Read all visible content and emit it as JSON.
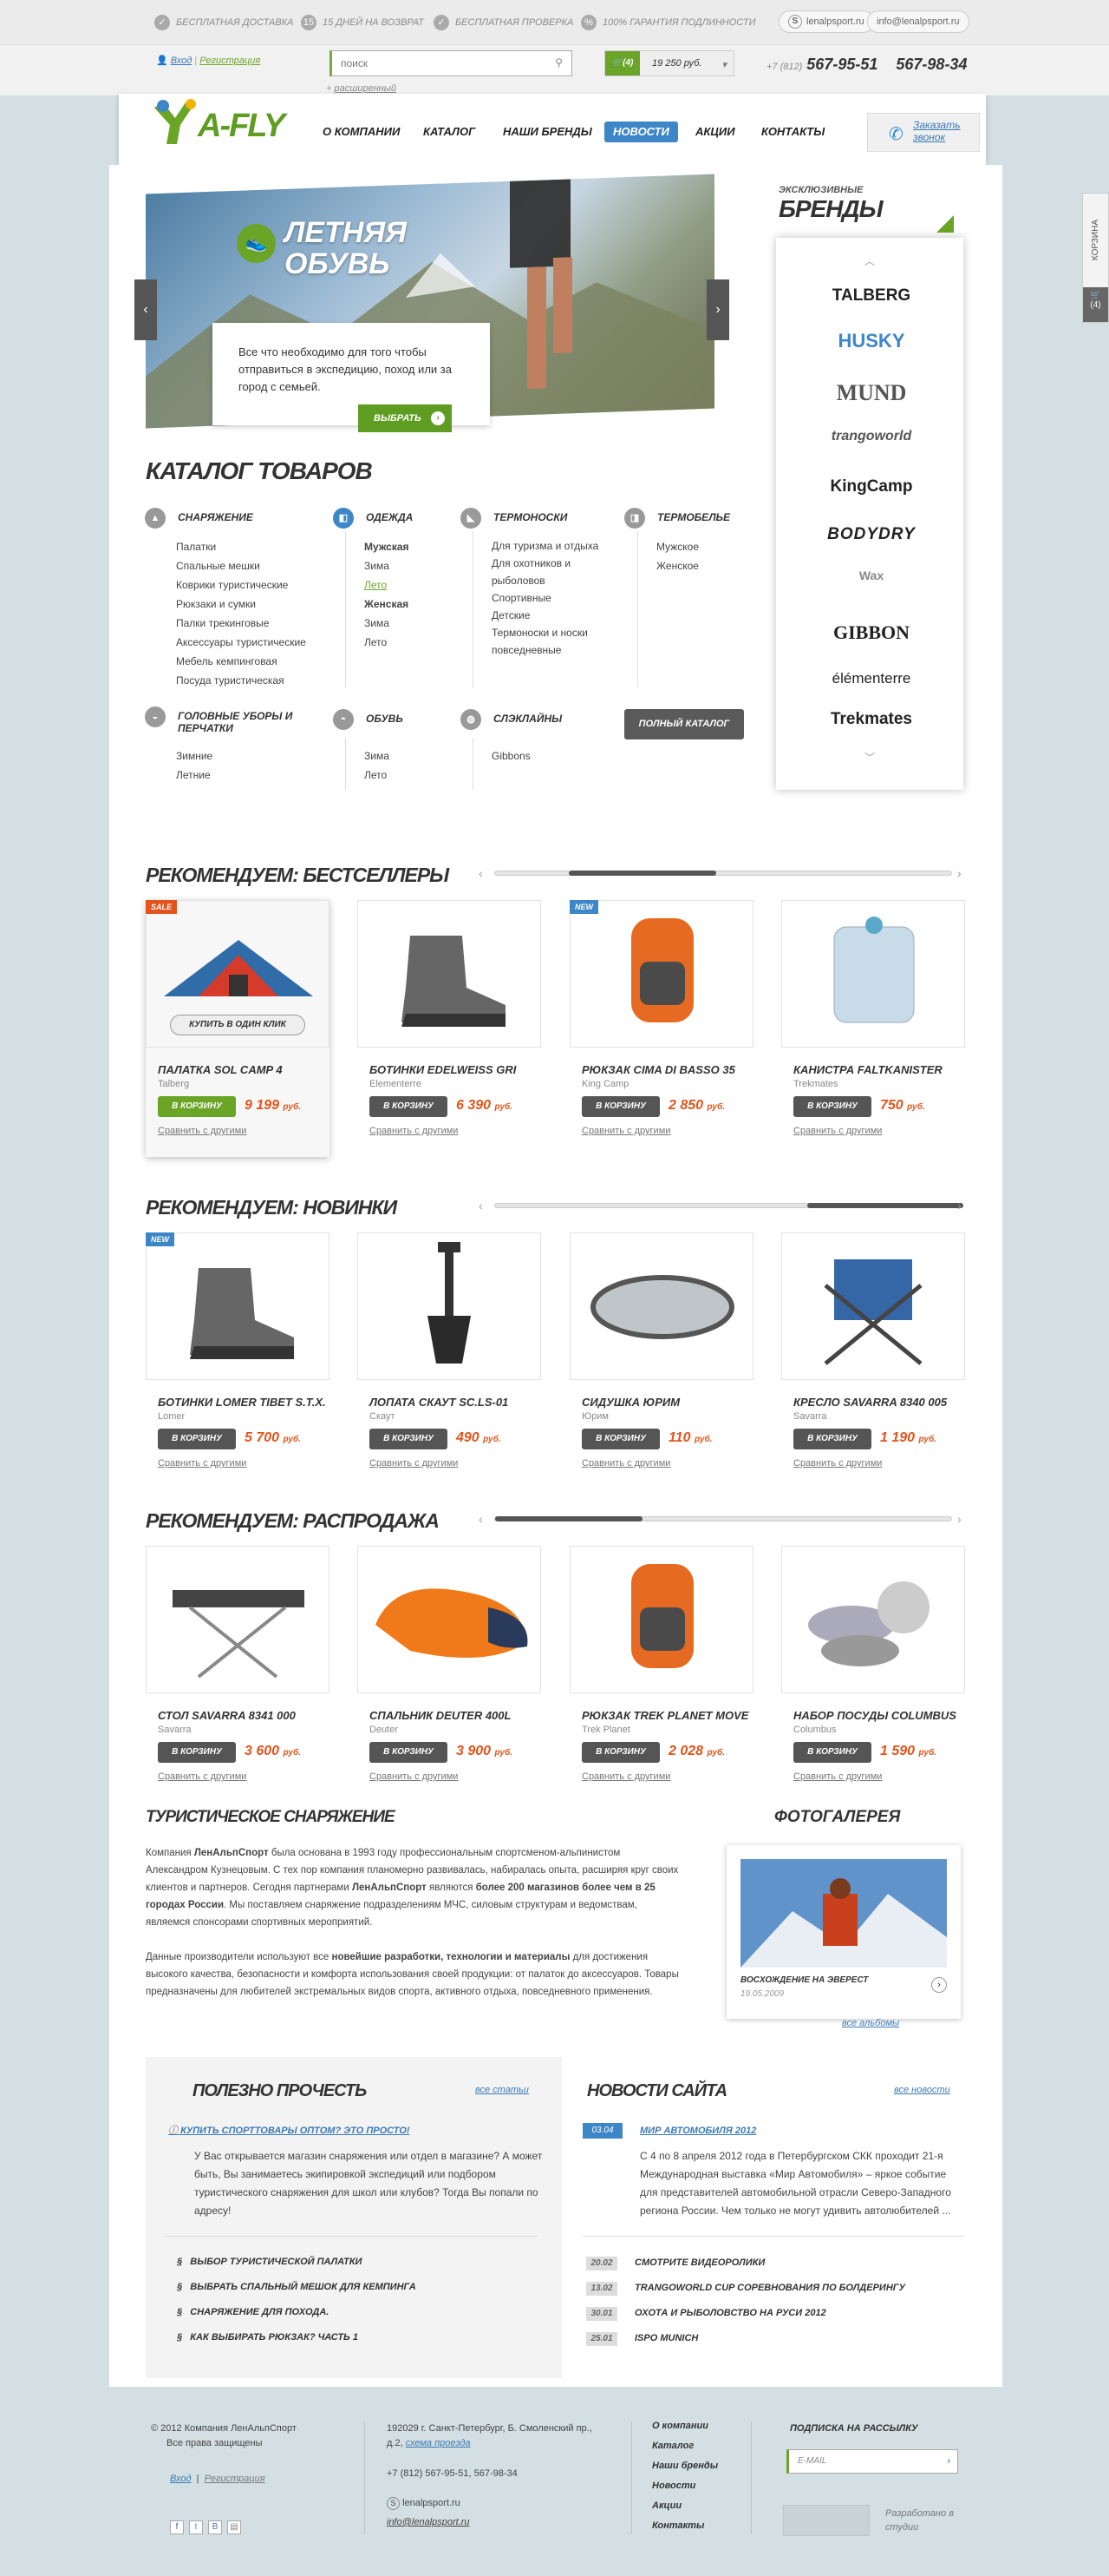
{
  "topbar": {
    "badges": [
      "БЕСПЛАТНАЯ ДОСТАВКА",
      "15 ДНЕЙ НА ВОЗВРАТ",
      "БЕСПЛАТНАЯ ПРОВЕРКА",
      "100% ГАРАНТИЯ ПОДЛИННОСТИ"
    ],
    "skype": "lenalpsport.ru",
    "email": "info@lenalpsport.ru"
  },
  "header": {
    "login": "Вход",
    "register": "Регистрация",
    "search_placeholder": "поиск",
    "advanced": "расширенный",
    "cart_count": "(4)",
    "cart_sum": "19 250 руб.",
    "phone_code": "+7 (812)",
    "phone1": "567-95-51",
    "phone2": "567-98-34",
    "logo_text": "A-FLY",
    "menu": [
      "О КОМПАНИИ",
      "КАТАЛОГ",
      "НАШИ БРЕНДЫ",
      "НОВОСТИ",
      "АКЦИИ",
      "КОНТАКТЫ"
    ],
    "callback": "Заказать звонок"
  },
  "side_tab": {
    "label": "КОРЗИНА",
    "count": "(4)"
  },
  "slider": {
    "title_line1": "ЛЕТНЯЯ",
    "title_line2": "ОБУВЬ",
    "text": "Все что необходимо для того чтобы отправиться в экспедицию, поход или за город с семьей.",
    "button": "ВЫБРАТЬ"
  },
  "brands": {
    "pre": "ЭКСКЛЮЗИВНЫЕ",
    "title": "БРЕНДЫ",
    "items": [
      "TALBERG",
      "HUSKY",
      "MUND",
      "trangoworld",
      "KingCamp",
      "BODYDRY",
      "Wax",
      "GIBBON",
      "élémenterre",
      "Trekmates"
    ]
  },
  "catalog": {
    "title": "КАТАЛОГ ТОВАРОВ",
    "cats": [
      {
        "name": "СНАРЯЖЕНИЕ",
        "items": [
          "Палатки",
          "Спальные мешки",
          "Коврики туристические",
          "Рюкзаки и сумки",
          "Палки трекинговые",
          "Аксессуары туристические",
          "Мебель кемпинговая",
          "Посуда туристическая"
        ]
      },
      {
        "name": "ОДЕЖДА",
        "items": [
          "Мужская",
          "Зима",
          "Лето",
          "Женская",
          "Зима",
          "Лето"
        ]
      },
      {
        "name": "ТЕРМОНОСКИ",
        "items": [
          "Для туризма и отдыха",
          "Для охотников и рыболовов",
          "Спортивные",
          "Детские",
          "Термоноски и носки повседневные"
        ]
      },
      {
        "name": "ТЕРМОБЕЛЬЕ",
        "items": [
          "Мужское",
          "Женское"
        ]
      },
      {
        "name": "ГОЛОВНЫЕ УБОРЫ И ПЕРЧАТКИ",
        "items": [
          "Зимние",
          "Летние"
        ]
      },
      {
        "name": "ОБУВЬ",
        "items": [
          "Зима",
          "Лето"
        ]
      },
      {
        "name": "СЛЭКЛАЙНЫ",
        "items": [
          "Gibbons"
        ]
      }
    ],
    "full": "ПОЛНЫЙ КАТАЛОГ"
  },
  "common": {
    "buy": "В КОРЗИНУ",
    "compare": "Сравнить с другими",
    "one_click": "КУПИТЬ В ОДИН КЛИК",
    "rub": "руб."
  },
  "sections": [
    {
      "title": "РЕКОМЕНДУЕМ:  БЕСТСЕЛЛЕРЫ",
      "products": [
        {
          "name": "ПАЛАТКА SOL CAMP 4",
          "brand": "Talberg",
          "price": "9 199",
          "tag": "SALE",
          "tag_color": "#e2541b",
          "icon": "tent-image"
        },
        {
          "name": "БОТИНКИ EDELWEISS GRI",
          "brand": "Elementerre",
          "price": "6 390",
          "tag": "",
          "icon": "boots-image"
        },
        {
          "name": "РЮКЗАК CIMA DI BASSO 35",
          "brand": "King Camp",
          "price": "2 850",
          "tag": "NEW",
          "tag_color": "#3d86c8",
          "icon": "backpack-image"
        },
        {
          "name": "КАНИСТРА FALTKANISTER",
          "brand": "Trekmates",
          "price": "750",
          "tag": "",
          "icon": "canister-image"
        }
      ]
    },
    {
      "title": "РЕКОМЕНДУЕМ:  НОВИНКИ",
      "products": [
        {
          "name": "БОТИНКИ LOMER TIBET S.T.X.",
          "brand": "Lomer",
          "price": "5 700",
          "tag": "NEW",
          "tag_color": "#3d86c8",
          "icon": "boots-image"
        },
        {
          "name": "ЛОПАТА СКАУТ SC.LS-01",
          "brand": "Скаут",
          "price": "490",
          "tag": "",
          "icon": "shovel-image"
        },
        {
          "name": "СИДУШКА ЮРИМ",
          "brand": "Юрим",
          "price": "110",
          "tag": "",
          "icon": "seat-pad-image"
        },
        {
          "name": "КРЕСЛО SAVARRA 8340 005",
          "brand": "Savarra",
          "price": "1 190",
          "tag": "",
          "icon": "chair-image"
        }
      ]
    },
    {
      "title": "РЕКОМЕНДУЕМ:  РАСПРОДАЖА",
      "products": [
        {
          "name": "СТОЛ SAVARRA 8341 000",
          "brand": "Savarra",
          "price": "3 600",
          "tag": "",
          "icon": "table-image"
        },
        {
          "name": "СПАЛЬНИК DEUTER 400L",
          "brand": "Deuter",
          "price": "3 900",
          "tag": "",
          "icon": "sleeping-bag-image"
        },
        {
          "name": "РЮКЗАК TREK PLANET MOVE",
          "brand": "Trek Planet",
          "price": "2 028",
          "tag": "",
          "icon": "backpack-image"
        },
        {
          "name": "НАБОР ПОСУДЫ COLUMBUS",
          "brand": "Columbus",
          "price": "1 590",
          "tag": "",
          "icon": "cookware-image"
        }
      ]
    }
  ],
  "about": {
    "title": "ТУРИСТИЧЕСКОЕ СНАРЯЖЕНИЕ",
    "p1_a": "Компания ",
    "p1_b": "ЛенАльпСпорт",
    "p1_c": " была основана в 1993 году профессиональным спортсменом-альпинистом Александром Кузнецовым. С тех пор компания планомерно развивалась, набиралась опыта, расширяя круг своих клиентов и партнеров. Сегодня партнерами ",
    "p1_d": "ЛенАльпСпорт",
    "p1_e": " являются ",
    "p1_f": "более 200 магазинов более чем в 25 городах России",
    "p1_g": ". Мы поставляем снаряжение подразделениям МЧС, силовым структурам и ведомствам, являемся спонсорами спортивных мероприятий.",
    "p2_a": "Данные производители используют все ",
    "p2_b": "новейшие разработки, технологии и материалы",
    "p2_c": " для достижения высокого качества, безопасности и комфорта использования своей продукции: от палаток до аксессуаров. Товары предназначены для любителей экстремальных видов спорта, активного отдыха, повседневного применения."
  },
  "gallery": {
    "title": "ФОТОГАЛЕРЕЯ",
    "caption": "ВОСХОЖДЕНИЕ НА ЭВЕРЕСТ",
    "date": "19.05.2009",
    "all": "все альбомы"
  },
  "read": {
    "title": "ПОЛЕЗНО ПРОЧЕСТЬ",
    "all": "все статьи",
    "featured": "КУПИТЬ СПОРТТОВАРЫ ОПТОМ? ЭТО ПРОСТО!",
    "text": "У Вас открывается магазин снаряжения или отдел в магазине? А может быть, Вы занимаетесь экипировкой экспедиций или подбором туристического снаряжения для школ или клубов? Тогда Вы попали по адресу!",
    "items": [
      "ВЫБОР ТУРИСТИЧЕСКОЙ ПАЛАТКИ",
      "ВЫБРАТЬ СПАЛЬНЫЙ МЕШОК ДЛЯ КЕМПИНГА",
      "СНАРЯЖЕНИЕ ДЛЯ ПОХОДА.",
      "КАК ВЫБИРАТЬ РЮКЗАК? ЧАСТЬ 1"
    ]
  },
  "news": {
    "title": "НОВОСТИ САЙТА",
    "all": "все новости",
    "featured_date": "03.04",
    "featured": "МИР АВТОМОБИЛЯ 2012",
    "text": "С 4 по 8 апреля 2012 года в Петербургском СКК проходит 21-я Международная выставка «Мир Автомобиля» – яркое событие для представителей автомобильной отрасли Северо-Западного региона России. Чем только не могут удивить автолюбителей ...",
    "items": [
      {
        "date": "20.02",
        "title": "СМОТРИТЕ ВИДЕОРОЛИКИ"
      },
      {
        "date": "13.02",
        "title": "TRANGOWORLD CUP СОРЕВНОВАНИЯ ПО БОЛДЕРИНГУ"
      },
      {
        "date": "30.01",
        "title": "ОХОТА И РЫБОЛОВСТВО НА РУСИ 2012"
      },
      {
        "date": "25.01",
        "title": "ISPO MUNICH"
      }
    ]
  },
  "footer": {
    "copy": "2012 Компания ЛенАльпСпорт",
    "rights": "Все права защищены",
    "login": "Вход",
    "register": "Регистрация",
    "address": "192029 г. Санкт-Петербург, Б. Смоленский пр., д.2,",
    "map": "схема проезда",
    "phones": "+7 (812) 567-95-51, 567-98-34",
    "skype": "lenalpsport.ru",
    "email": "info@lenalpsport.ru",
    "links": [
      "О компании",
      "Каталог",
      "Наши бренды",
      "Новости",
      "Акции",
      "Контакты"
    ],
    "subscribe": "ПОДПИСКА НА РАССЫЛКУ",
    "email_placeholder": "E-MAIL",
    "studio": "Разработано в студии"
  }
}
